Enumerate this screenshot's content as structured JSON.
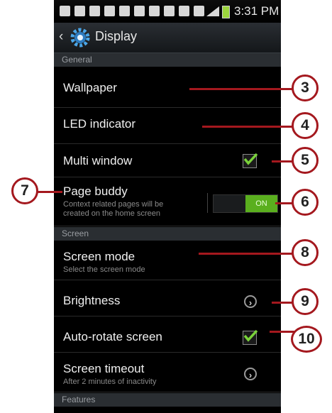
{
  "status_bar": {
    "time": "3:31 PM"
  },
  "action_bar": {
    "back_icon": "chevron-left-icon",
    "app_icon": "gear-icon",
    "title": "Display"
  },
  "sections": {
    "general": "General",
    "screen": "Screen",
    "features": "Features"
  },
  "items": {
    "wallpaper": {
      "title": "Wallpaper"
    },
    "led": {
      "title": "LED indicator"
    },
    "multi_window": {
      "title": "Multi window",
      "checked": true
    },
    "page_buddy": {
      "title": "Page buddy",
      "subtitle_1": "Context related pages will be",
      "subtitle_2": "created on the home screen",
      "toggle": "ON"
    },
    "screen_mode": {
      "title": "Screen mode",
      "subtitle": "Select the screen mode"
    },
    "brightness": {
      "title": "Brightness"
    },
    "auto_rotate": {
      "title": "Auto-rotate screen",
      "checked": true
    },
    "screen_timeout": {
      "title": "Screen timeout",
      "subtitle": "After 2 minutes of inactivity"
    }
  },
  "callouts": [
    "3",
    "4",
    "5",
    "6",
    "7",
    "8",
    "9",
    "10"
  ],
  "colors": {
    "accent_green": "#5aaf1e",
    "callout_red": "#a4181e",
    "background": "#000000"
  }
}
